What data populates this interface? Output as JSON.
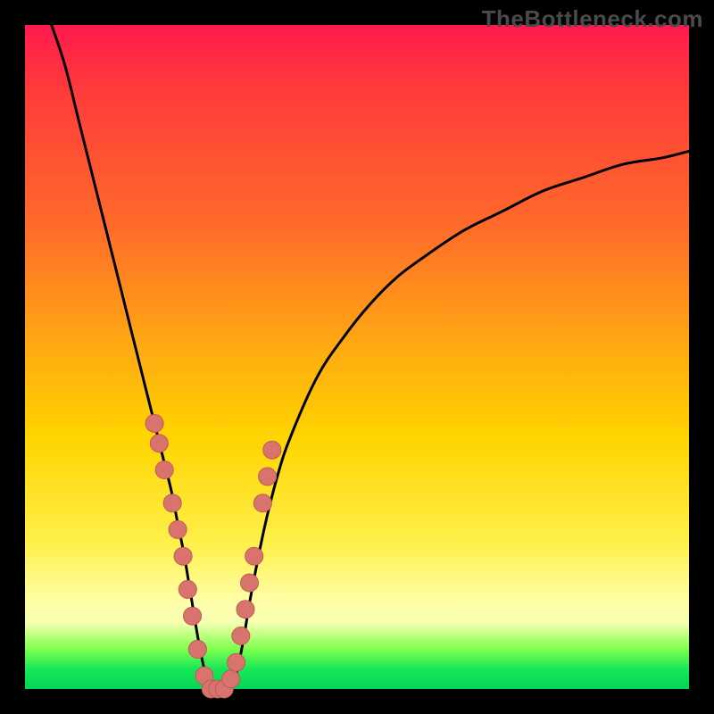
{
  "watermark": {
    "text": "TheBottleneck.com"
  },
  "colors": {
    "background": "#000000",
    "curve": "#000000",
    "dot_fill": "#d9736e",
    "dot_stroke": "#c05a55",
    "gradient_stops": [
      "#ff1a4d",
      "#ff3b3b",
      "#ff6a2a",
      "#ffa812",
      "#ffd400",
      "#fff04a",
      "#ffffaa",
      "#f7ffb0",
      "#7dff4d",
      "#18e856",
      "#00d65a"
    ]
  },
  "chart_data": {
    "type": "line",
    "title": "",
    "xlabel": "",
    "ylabel": "",
    "xlim": [
      0,
      100
    ],
    "ylim": [
      0,
      100
    ],
    "x": [
      4,
      6,
      8,
      10,
      12,
      14,
      16,
      18,
      20,
      21,
      22,
      23,
      24,
      25,
      26,
      27,
      28,
      29,
      30,
      31,
      32,
      33,
      34,
      36,
      38,
      40,
      44,
      48,
      52,
      56,
      60,
      66,
      72,
      78,
      84,
      90,
      96,
      100
    ],
    "y": [
      100,
      94,
      86,
      78,
      70,
      62,
      54,
      46,
      38,
      34,
      30,
      25,
      20,
      14,
      8,
      3,
      0,
      0,
      0,
      0,
      3,
      8,
      14,
      24,
      32,
      38,
      47,
      53,
      58,
      62,
      65,
      69,
      72,
      75,
      77,
      79,
      80,
      81
    ],
    "dots_x": [
      19.5,
      20.2,
      21.0,
      22.2,
      23.0,
      23.8,
      24.5,
      25.2,
      26.0,
      27.0,
      28.0,
      29.0,
      30.0,
      31.0,
      31.8,
      32.5,
      33.2,
      33.8,
      34.5,
      35.8,
      36.5,
      37.2
    ],
    "dots_y": [
      40,
      37,
      33,
      28,
      24,
      20,
      15,
      11,
      6,
      2,
      0,
      0,
      0,
      1.5,
      4,
      8,
      12,
      16,
      20,
      28,
      32,
      36
    ]
  }
}
